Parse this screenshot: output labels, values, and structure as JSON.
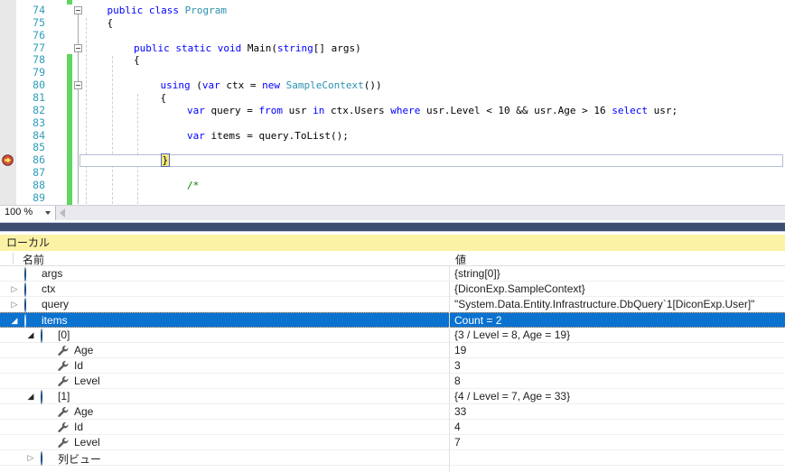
{
  "editor": {
    "zoom_value": "100 %",
    "lines": [
      {
        "num": "74",
        "indent": 1,
        "fold": true,
        "green": false,
        "tokens": [
          {
            "c": "k",
            "t": "public class "
          },
          {
            "c": "t",
            "t": "Program"
          }
        ]
      },
      {
        "num": "75",
        "indent": 1,
        "green": false,
        "tokens": [
          {
            "c": "p",
            "t": "{"
          }
        ]
      },
      {
        "num": "76",
        "indent": 0,
        "green": false,
        "tokens": []
      },
      {
        "num": "77",
        "indent": 2,
        "fold": true,
        "green": false,
        "tokens": [
          {
            "c": "k",
            "t": "public static void "
          },
          {
            "c": "p",
            "t": "Main("
          },
          {
            "c": "k",
            "t": "string"
          },
          {
            "c": "p",
            "t": "[] args)"
          }
        ]
      },
      {
        "num": "78",
        "indent": 2,
        "green": true,
        "tokens": [
          {
            "c": "p",
            "t": "{"
          }
        ]
      },
      {
        "num": "79",
        "indent": 0,
        "green": true,
        "tokens": []
      },
      {
        "num": "80",
        "indent": 3,
        "fold": true,
        "green": true,
        "tokens": [
          {
            "c": "k",
            "t": "using"
          },
          {
            "c": "p",
            "t": " ("
          },
          {
            "c": "k",
            "t": "var"
          },
          {
            "c": "p",
            "t": " ctx = "
          },
          {
            "c": "k",
            "t": "new"
          },
          {
            "c": "p",
            "t": " "
          },
          {
            "c": "t",
            "t": "SampleContext"
          },
          {
            "c": "p",
            "t": "())"
          }
        ]
      },
      {
        "num": "81",
        "indent": 3,
        "green": true,
        "tokens": [
          {
            "c": "p",
            "t": "{"
          }
        ]
      },
      {
        "num": "82",
        "indent": 4,
        "green": true,
        "tokens": [
          {
            "c": "k",
            "t": "var"
          },
          {
            "c": "p",
            "t": " query = "
          },
          {
            "c": "k",
            "t": "from"
          },
          {
            "c": "p",
            "t": " usr "
          },
          {
            "c": "k",
            "t": "in"
          },
          {
            "c": "p",
            "t": " ctx.Users "
          },
          {
            "c": "k",
            "t": "where"
          },
          {
            "c": "p",
            "t": " usr.Level < 10 && usr.Age > 16 "
          },
          {
            "c": "k",
            "t": "select"
          },
          {
            "c": "p",
            "t": " usr;"
          }
        ]
      },
      {
        "num": "83",
        "indent": 0,
        "green": true,
        "tokens": []
      },
      {
        "num": "84",
        "indent": 4,
        "green": true,
        "tokens": [
          {
            "c": "k",
            "t": "var"
          },
          {
            "c": "p",
            "t": " items = query.ToList();"
          }
        ]
      },
      {
        "num": "85",
        "indent": 0,
        "green": true,
        "tokens": []
      },
      {
        "num": "86",
        "indent": 3,
        "green": true,
        "breakpoint": true,
        "current": true,
        "tokens": [
          {
            "c": "p",
            "t": "}",
            "hl": true
          }
        ]
      },
      {
        "num": "87",
        "indent": 0,
        "green": true,
        "tokens": []
      },
      {
        "num": "88",
        "indent": 4,
        "green": true,
        "tokens": [
          {
            "c": "c",
            "t": "/*"
          }
        ]
      },
      {
        "num": "89",
        "indent": 0,
        "green": true,
        "tokens": []
      }
    ]
  },
  "locals": {
    "title": "ローカル",
    "name_header": "名前",
    "value_header": "値",
    "rows": [
      {
        "name": "args",
        "value": "{string[0]}",
        "level": 0,
        "icon": "object",
        "expand": "none",
        "selected": false
      },
      {
        "name": "ctx",
        "value": "{DiconExp.SampleContext}",
        "level": 0,
        "icon": "object",
        "expand": "collapsed",
        "selected": false
      },
      {
        "name": "query",
        "value": "\"System.Data.Entity.Infrastructure.DbQuery`1[DiconExp.User]\"",
        "level": 0,
        "icon": "object",
        "expand": "collapsed",
        "selected": false
      },
      {
        "name": "items",
        "value": "Count = 2",
        "level": 0,
        "icon": "object",
        "expand": "expanded",
        "selected": true
      },
      {
        "name": "[0]",
        "value": "{3 / Level = 8, Age = 19}",
        "level": 1,
        "icon": "object",
        "expand": "expanded",
        "selected": false
      },
      {
        "name": "Age",
        "value": "19",
        "level": 2,
        "icon": "property",
        "expand": "none",
        "selected": false
      },
      {
        "name": "Id",
        "value": "3",
        "level": 2,
        "icon": "property",
        "expand": "none",
        "selected": false
      },
      {
        "name": "Level",
        "value": "8",
        "level": 2,
        "icon": "property",
        "expand": "none",
        "selected": false
      },
      {
        "name": "[1]",
        "value": "{4 / Level = 7, Age = 33}",
        "level": 1,
        "icon": "object",
        "expand": "expanded",
        "selected": false
      },
      {
        "name": "Age",
        "value": "33",
        "level": 2,
        "icon": "property",
        "expand": "none",
        "selected": false
      },
      {
        "name": "Id",
        "value": "4",
        "level": 2,
        "icon": "property",
        "expand": "none",
        "selected": false
      },
      {
        "name": "Level",
        "value": "7",
        "level": 2,
        "icon": "property",
        "expand": "none",
        "selected": false
      },
      {
        "name": "列ビュー",
        "value": "",
        "level": 1,
        "icon": "object",
        "expand": "collapsed",
        "selected": false
      }
    ]
  },
  "colors": {
    "keyword": "#0000ff",
    "type": "#2b91af",
    "comment": "#008000",
    "line_number": "#2f9cba",
    "change_bar": "#5fd65f",
    "selection": "#0b72d0",
    "locals_title_bg": "#fbf2a6",
    "splitter": "#3d4e71",
    "current_statement_bg": "#f7e87c",
    "breakpoint": "#c94f41"
  }
}
